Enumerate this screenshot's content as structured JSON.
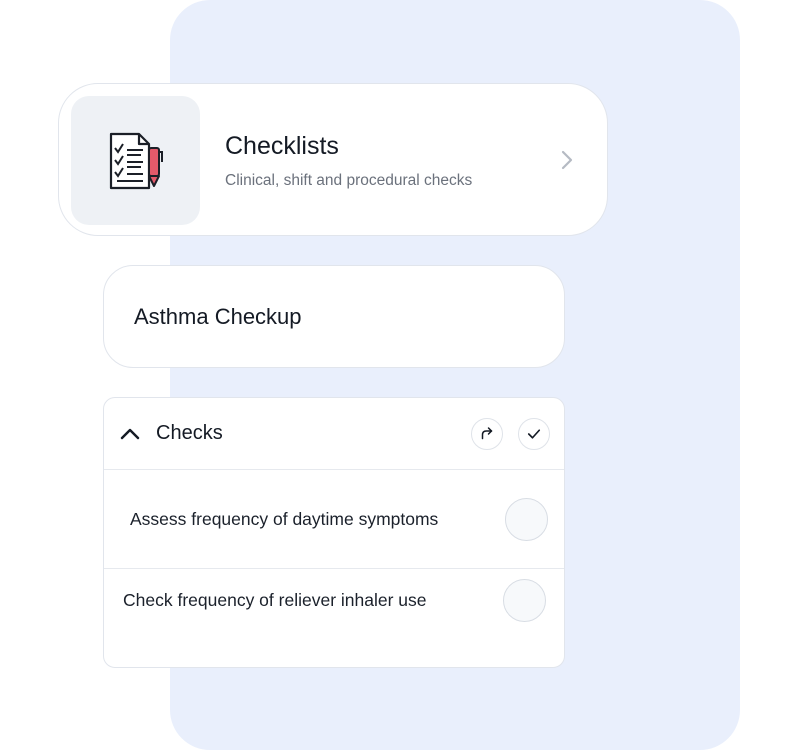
{
  "checklists_card": {
    "title": "Checklists",
    "subtitle": "Clinical, shift and procedural checks",
    "icon": "checklist-document-pen-icon"
  },
  "asthma_card": {
    "title": "Asthma Checkup"
  },
  "checks_section": {
    "title": "Checks",
    "collapse_icon": "chevron-up-icon",
    "actions": [
      {
        "icon": "redo-arrow-icon"
      },
      {
        "icon": "checkmark-icon"
      }
    ],
    "items": [
      {
        "label": "Assess frequency of daytime symptoms",
        "checked": false
      },
      {
        "label": "Check frequency of reliever inhaler use",
        "checked": false
      }
    ]
  },
  "colors": {
    "background_panel": "#e9effc",
    "icon_tile": "#eef1f5",
    "pen_accent": "#e35a6a",
    "border": "#e1e5ec"
  }
}
